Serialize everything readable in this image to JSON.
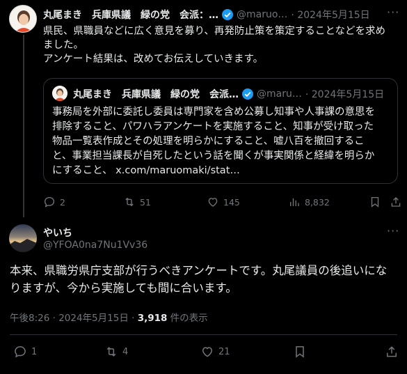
{
  "colors": {
    "background": "#000000",
    "text": "#e7e9ea",
    "muted": "#71767b",
    "verified": "#1d9bf0",
    "border": "#2f3336"
  },
  "parent_tweet": {
    "display_name": "丸尾まき　兵庫県議　緑の党　会派：…",
    "handle": "@maruo…",
    "date": "· 2024年5月15日",
    "verified_icon": "verified-badge-icon",
    "text_line1": "県民、県職員などに広く意見を募り、再発防止策を策定することなどを求め",
    "text_line2": "ました。",
    "text_line3": "アンケート結果は、改めてお伝えしていきます。",
    "quote": {
      "display_name": "丸尾まき　兵庫県議　緑の党　会派…",
      "handle": "@maru…",
      "date": "· 2024年5月15日",
      "line1": "事務局を外部に委託し委員は専門家を含め公募し知事や人事課の意思を",
      "line2": "排除すること、パワハラアンケートを実施すること、知事が受け取った",
      "line3": "物品一覧表作成とその処理を明らかにすること、嘘八百を撤回するこ",
      "line4": "と、事業担当課長が自死したという話を聞くが事実関係と経緯を明らか",
      "line5": "にすること、 x.com/maruomaki/stat…"
    },
    "actions": {
      "replies": "2",
      "retweets": "51",
      "likes": "145",
      "views": "8,832"
    }
  },
  "main_tweet": {
    "display_name": "やいち",
    "handle": "@YFOA0na7Nu1Vv36",
    "text_line1": "本来、県職労県庁支部が行うべきアンケートです。丸尾議員の後追いにな",
    "text_line2": "りますが、今から実施しても間に合います。",
    "time": "午後8:26 · 2024年5月15日 · ",
    "views_count": "3,918",
    "views_label": " 件の表示",
    "actions": {
      "replies": "1",
      "retweets": "4",
      "likes": "21"
    }
  }
}
